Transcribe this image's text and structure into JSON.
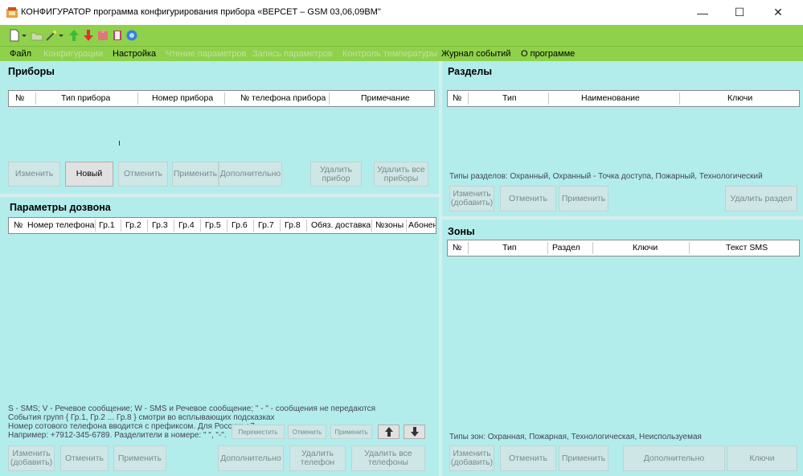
{
  "window": {
    "title": "КОНФИГУРАТОР программа конфигурирования прибора «ВЕРСЕТ – GSM 03,06,09ВМ\"",
    "controls": {
      "minimize": "—",
      "maximize": "☐",
      "close": "✕"
    }
  },
  "menu": [
    "Файл",
    "Конфигурации",
    "Настройка",
    "Чтение параметров",
    "Запись параметров",
    "Контроль температуры",
    "Журнал событий",
    "О программе"
  ],
  "devices": {
    "title": "Приборы",
    "columns": [
      "№",
      "Тип прибора",
      "Номер прибора",
      "№ телефона прибора",
      "Примечание"
    ],
    "buttons": {
      "edit": "Изменить",
      "new": "Новый",
      "cancel": "Отменить",
      "apply": "Применить",
      "more": "Дополнительно",
      "delete1": "Удалить",
      "delete2": "прибор",
      "deleteall1": "Удалить все",
      "deleteall2": "приборы"
    }
  },
  "dial": {
    "title": "Параметры дозвона",
    "columns": [
      "№",
      "Номер телефона",
      "Гр.1",
      "Гр.2",
      "Гр.3",
      "Гр.4",
      "Гр.5",
      "Гр.6",
      "Гр.7",
      "Гр.8",
      "Обяз. доставка",
      "№зоны",
      "Абонент"
    ],
    "notes": {
      "line1": "S - SMS;  V - Речевое сообщение;  W - SMS и Речевое сообщение; \" - \" - сообщения не передаются",
      "line2": "События групп { Гр.1, Гр.2 ... Гр.8 } смотри во всплывающих подсказках",
      "line3": "Номер сотового телефона вводится с префиксом. Для России: +7.",
      "line4": "Например: +7912-345-6789. Разделители в номере: \" \", \"-\"."
    },
    "small_buttons": {
      "move": "Переместить",
      "cancel": "Отменить",
      "apply": "Применить"
    },
    "buttons": {
      "edit1": "Изменить",
      "edit2": "(добавить)",
      "cancel": "Отменить",
      "apply": "Применить",
      "more": "Дополнительно",
      "delete1": "Удалить",
      "delete2": "телефон",
      "deleteall1": "Удалить все",
      "deleteall2": "телефоны"
    }
  },
  "sections": {
    "title": "Разделы",
    "columns": [
      "№",
      "Тип",
      "Наименование",
      "Ключи"
    ],
    "types_note": "Типы разделов: Охранный, Охранный - Точка доступа, Пожарный, Технологический",
    "buttons": {
      "edit1": "Изменить",
      "edit2": "(добавить)",
      "cancel": "Отменить",
      "apply": "Применить",
      "delete": "Удалить раздел"
    }
  },
  "zones": {
    "title": "Зоны",
    "columns": [
      "№",
      "Тип",
      "Раздел",
      "Ключи",
      "Текст SMS"
    ],
    "types_note": "Типы зон: Охранная, Пожарная, Технологическая, Неиспользуемая",
    "buttons": {
      "edit1": "Изменить",
      "edit2": "(добавить)",
      "cancel": "Отменить",
      "apply": "Применить",
      "more": "Дополнительно",
      "keys": "Ключи"
    }
  },
  "colors": {
    "toolbar": "#8fd14b",
    "panel": "#b2edec",
    "disabled_text": "#7a8b8b"
  }
}
